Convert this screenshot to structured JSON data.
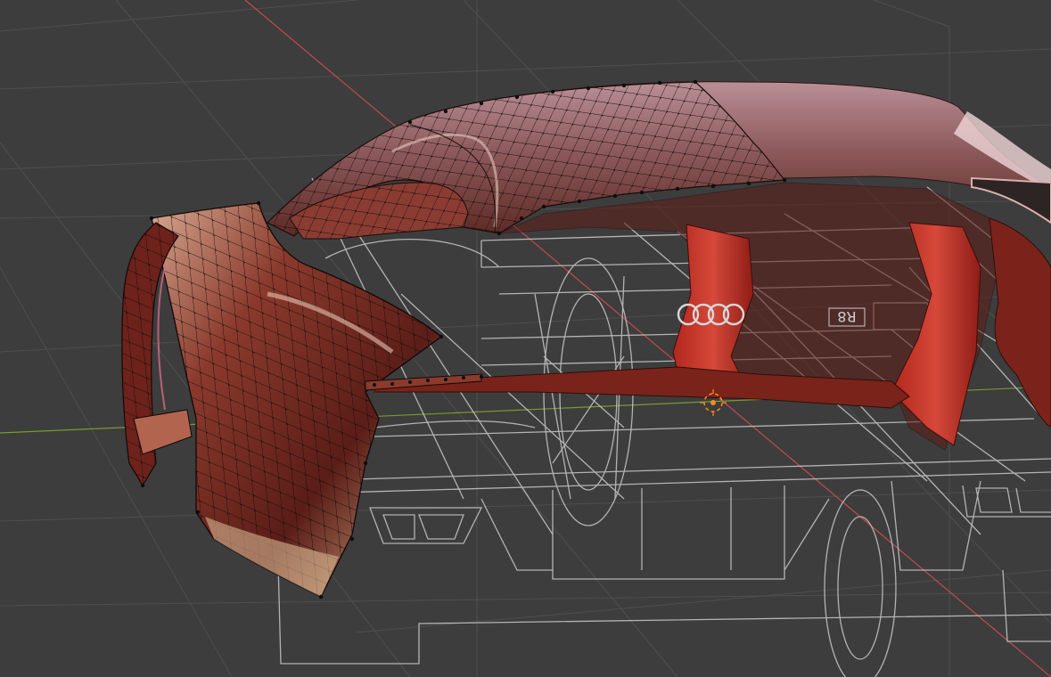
{
  "viewport": {
    "background_color": "#3d3d3d",
    "grid_color": "#4e4e4e",
    "x_axis_color": "#c04a52",
    "y_axis_color": "#7a9a2e"
  },
  "model": {
    "body_color": "#8a2a22",
    "highlight_color": "#d9b7a8",
    "wire_color": "#c8c8c8",
    "vertex_color": "#0e0e0e",
    "emblem_icon": "four-rings-logo-icon",
    "badge_text": "R8"
  },
  "cursor": {
    "icon": "3d-cursor-icon",
    "color": "#ff8a20"
  }
}
